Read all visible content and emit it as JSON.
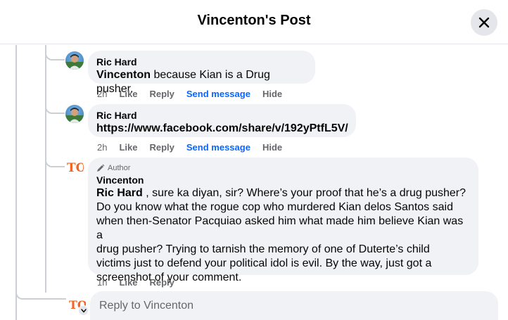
{
  "header": {
    "title": "Vincenton's Post",
    "close_icon": "close-icon"
  },
  "comments": [
    {
      "author": "Ric Hard",
      "mention": "Vincenton",
      "text": " because Kian is a Drug pusher.",
      "actions": {
        "time": "2h",
        "like": "Like",
        "reply": "Reply",
        "send": "Send message",
        "hide": "Hide"
      }
    },
    {
      "author": "Ric Hard",
      "link": "https://www.facebook.com/share/v/192yPtfL5V/",
      "actions": {
        "time": "2h",
        "like": "Like",
        "reply": "Reply",
        "send": "Send message",
        "hide": "Hide"
      }
    },
    {
      "badge": "Author",
      "author": "Vincenton",
      "mention": "Ric Hard",
      "lines": [
        " , sure ka diyan, sir? Where’s your proof that he’s a drug pusher?",
        "Do you know what the rogue cop who murdered Kian delos Santos said",
        "when then-Senator Pacquiao asked him what made him believe Kian was a",
        "drug pusher? Trying to tarnish the memory of one of Duterte’s child",
        "victims just to defend your political idol is evil. By the way, just got a",
        "screenshot of your comment."
      ],
      "actions": {
        "time": "1h",
        "like": "Like",
        "reply": "Reply"
      }
    }
  ],
  "reply_box": {
    "placeholder": "Reply to Vincenton"
  },
  "colors": {
    "link_blue": "#0866ff",
    "logo_orange": "#f26522",
    "bubble_bg": "#f0f2f5",
    "secondary_text": "#65676b"
  }
}
